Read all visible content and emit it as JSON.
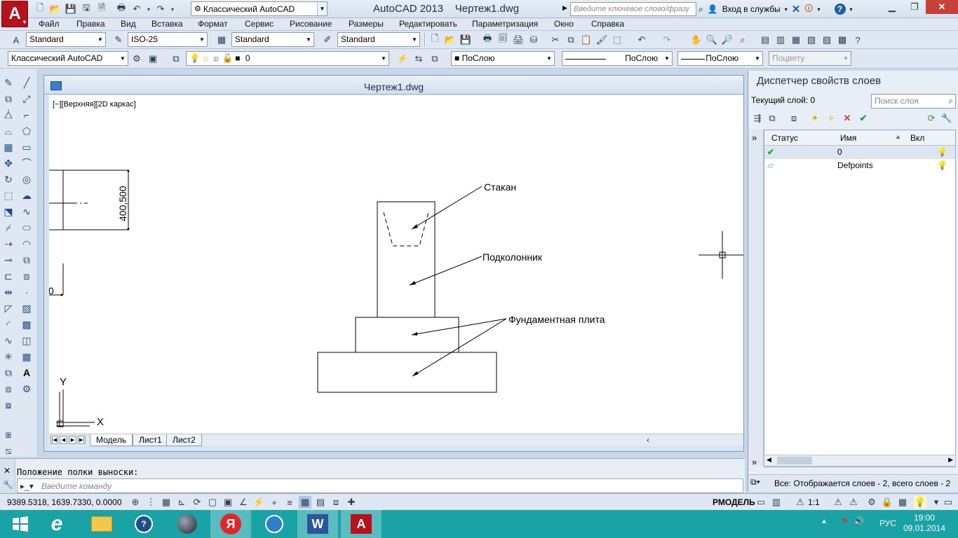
{
  "titlebar": {
    "workspace": "Классический AutoCAD",
    "app_name": "AutoCAD 2013",
    "file_name": "Чертеж1.dwg",
    "search_placeholder": "Введите ключевое слово/фразу",
    "signin_label": "Вход в службы",
    "logo_letter": "A"
  },
  "menu": [
    "Файл",
    "Правка",
    "Вид",
    "Вставка",
    "Формат",
    "Сервис",
    "Рисование",
    "Размеры",
    "Редактировать",
    "Параметризация",
    "Окно",
    "Справка"
  ],
  "toolbar1": {
    "text_style": "Standard",
    "dim_style": "ISO-25",
    "table_style": "Standard",
    "mleader_style": "Standard"
  },
  "toolbar2": {
    "workspace": "Классический AutoCAD",
    "layer": "0",
    "color": "ПоСлою",
    "linetype": "ПоСлою",
    "lineweight": "ПоСлою",
    "plotstyle": "Поцвету"
  },
  "document": {
    "title": "Чертеж1.dwg",
    "view_label": "[−][Верхняя][2D каркас]",
    "tabs": [
      "Модель",
      "Лист1",
      "Лист2"
    ],
    "scroll_left": "‹"
  },
  "drawing": {
    "dimension_text": "400,500",
    "edge_text": "0",
    "labels": {
      "glass": "Стакан",
      "column": "Подколонник",
      "slab": "Фундаментная плита"
    },
    "ucs_x": "X",
    "ucs_y": "Y"
  },
  "layer_panel": {
    "title": "Диспетчер свойств слоев",
    "current_layer": "Текущий слой: 0",
    "search_placeholder": "Поиск слоя",
    "columns": [
      "Статус",
      "Имя",
      "Вкл"
    ],
    "layers": [
      {
        "name": "0",
        "status": "current"
      },
      {
        "name": "Defpoints",
        "status": "normal"
      }
    ],
    "status_text": "Все: Отображается слоев - 2, всего слоев - 2"
  },
  "command": {
    "history": "Положение полки выноски:",
    "placeholder": "Введите команду"
  },
  "statusbar": {
    "coords": "9389.5318, 1639.7330, 0.0000",
    "space": "РМОДЕЛЬ",
    "scale": "1:1"
  },
  "taskbar": {
    "language": "РУС",
    "time": "19:00",
    "date": "09.01.2014",
    "apps": [
      "start",
      "internet-explorer",
      "file-explorer",
      "help",
      "media",
      "yandex-browser",
      "remote",
      "word",
      "autocad"
    ]
  },
  "colors": {
    "accent": "#1aa3a6",
    "logo": "#b5121b",
    "close": "#c7403a"
  }
}
